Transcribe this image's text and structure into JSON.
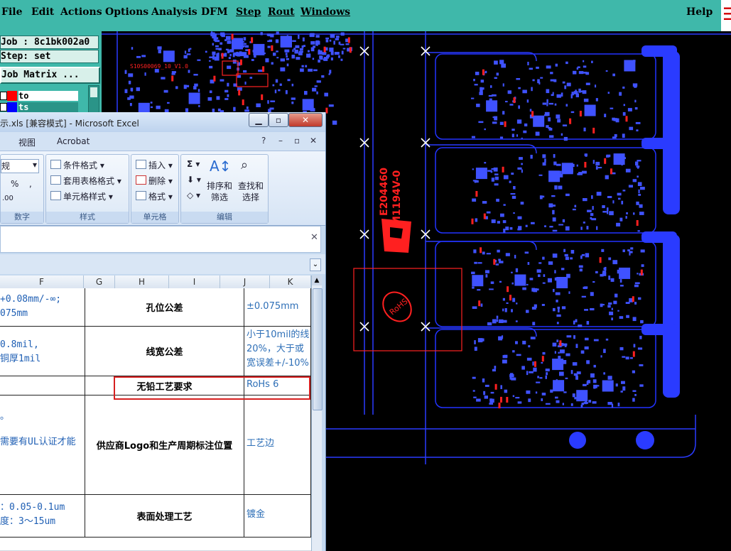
{
  "menubar": {
    "items": [
      "File",
      "Edit",
      "Actions",
      "Options",
      "Analysis",
      "DFM",
      "Step",
      "Rout",
      "Windows"
    ],
    "help": "Help"
  },
  "left_panel": {
    "job_field": "Job : 8c1bk002a0",
    "step_field": "Step: set",
    "job_matrix_button": "Job Matrix ...",
    "layers": [
      {
        "name": "to",
        "color": "#ff0000"
      },
      {
        "name": "ts",
        "color": "#0000ff"
      }
    ]
  },
  "canvas": {
    "label_small": "S10S00069_10_V1.0",
    "ul_text_1": "E204460",
    "ul_text_2": "M1194V-0",
    "rohs_text": "RoHS"
  },
  "excel": {
    "title": "示.xls [兼容模式] - Microsoft Excel",
    "tabs": [
      "视图",
      "Acrobat"
    ],
    "ribbon": {
      "number": {
        "format_value": "规",
        "buttons": [
          "%",
          ","
        ],
        "label": "数字"
      },
      "styles": {
        "items": [
          "条件格式",
          "套用表格格式",
          "单元格样式"
        ],
        "label": "样式"
      },
      "cells": {
        "items": [
          "插入",
          "删除",
          "格式"
        ],
        "label": "单元格"
      },
      "editing": {
        "sort": "排序和\n筛选",
        "find": "查找和\n选择",
        "label": "编辑"
      }
    },
    "columns": [
      "F",
      "G",
      "H",
      "I",
      "J",
      "K"
    ],
    "rows": [
      {
        "left": "+0.08mm/-∞;\n075mm",
        "label": "孔位公差",
        "value": "±0.075mm"
      },
      {
        "left": "0.8mil,\n铜厚1mil",
        "label": "线宽公差",
        "value": "小于10mil的线\n20%，大于或\n宽误差+/-10%"
      },
      {
        "left": "",
        "label": "无铅工艺要求",
        "value": "RoHs 6"
      },
      {
        "left": "。\n需要有UL认证才能",
        "label": "供应商Logo和生产周期标注位置",
        "value": "工艺边"
      },
      {
        "left": "：0.05-0.1um\n度：3～15um",
        "label": "表面处理工艺",
        "value": "镀金"
      }
    ]
  }
}
